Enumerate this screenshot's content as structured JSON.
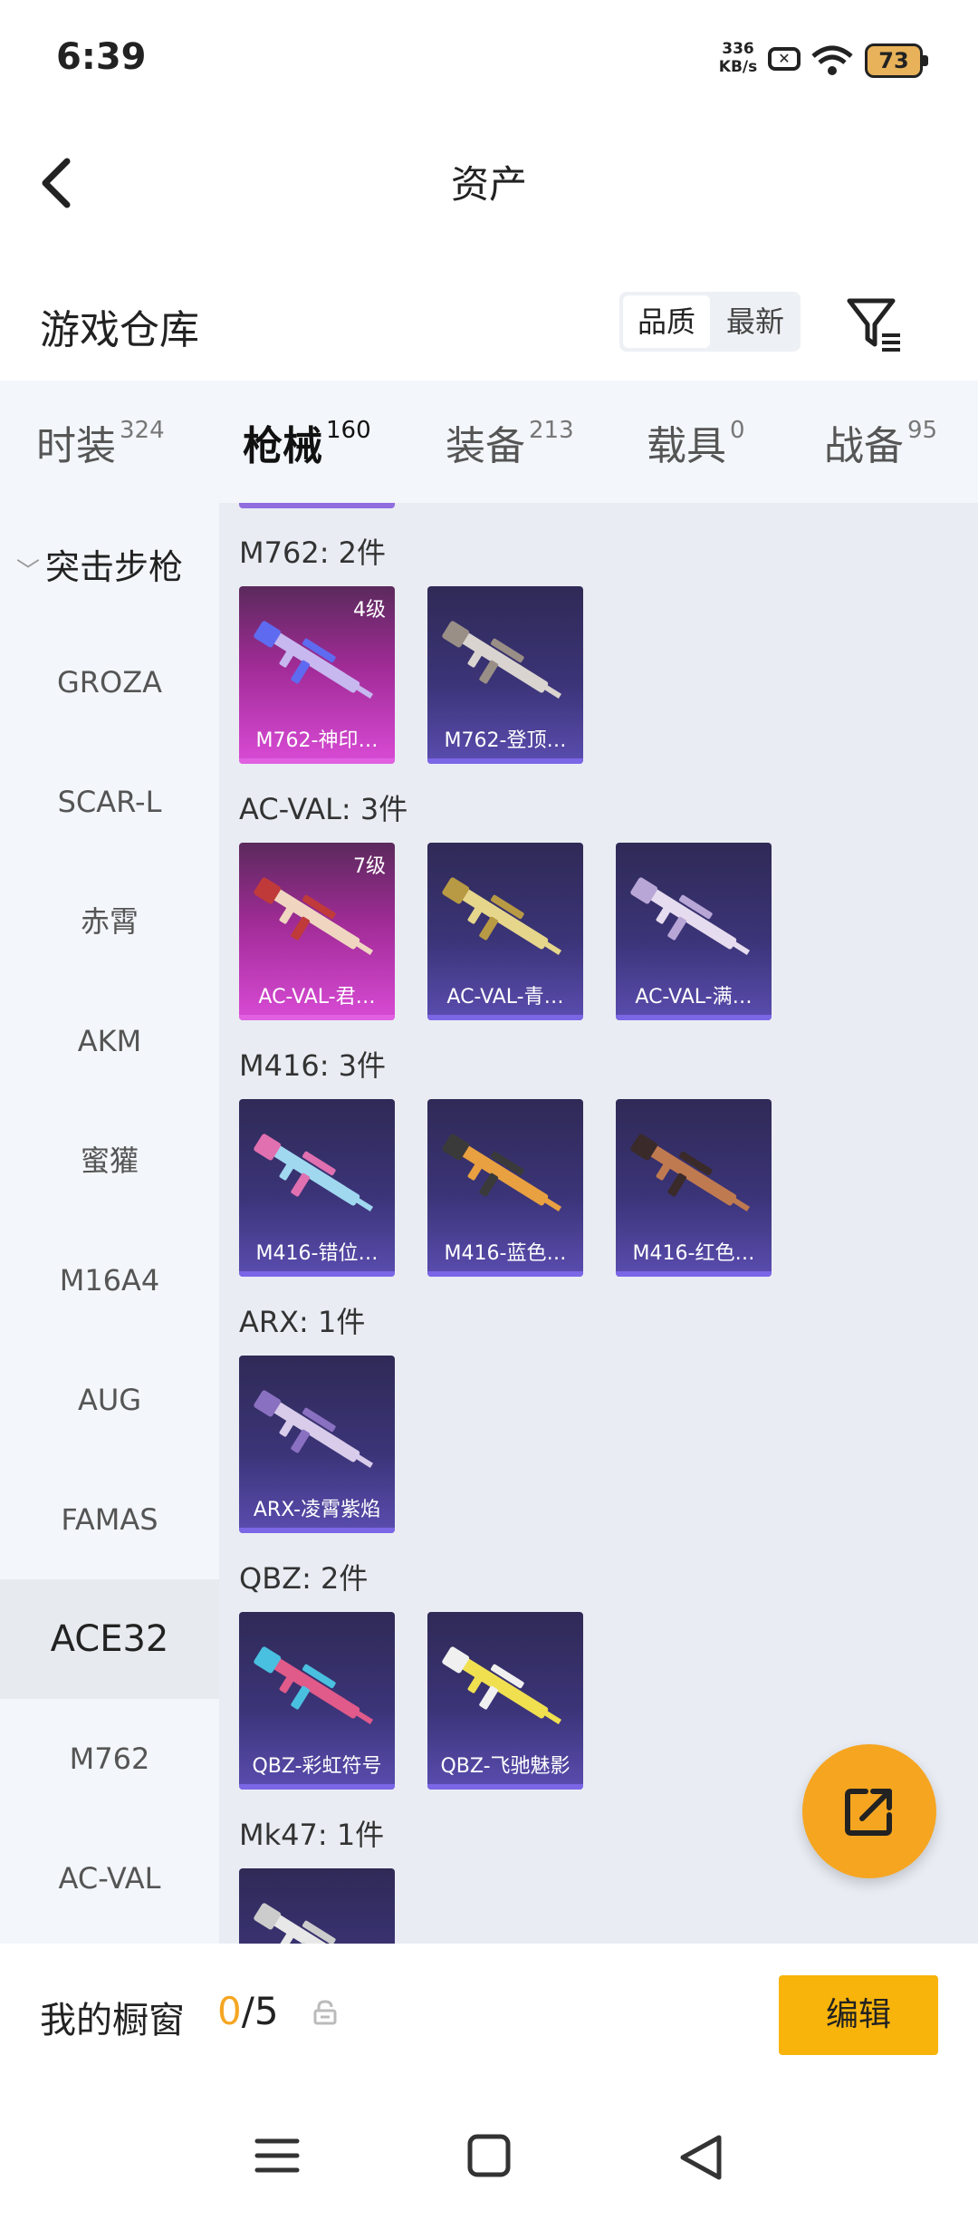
{
  "status": {
    "time": "6:39",
    "net_speed": "336",
    "net_unit": "KB/s",
    "wifi_sub": "6",
    "battery": "73"
  },
  "header": {
    "title": "资产"
  },
  "warehouse": {
    "title": "游戏仓库",
    "sort_quality": "品质",
    "sort_newest": "最新"
  },
  "tabs": [
    {
      "label": "时装",
      "count": "324"
    },
    {
      "label": "枪械",
      "count": "160"
    },
    {
      "label": "装备",
      "count": "213"
    },
    {
      "label": "载具",
      "count": "0"
    },
    {
      "label": "战备",
      "count": "95"
    }
  ],
  "sidebar": {
    "group": "突击步枪",
    "items": [
      "GROZA",
      "SCAR-L",
      "赤霄",
      "AKM",
      "蜜獾",
      "M16A4",
      "AUG",
      "FAMAS",
      "ACE32",
      "M762",
      "AC-VAL"
    ]
  },
  "sections": [
    {
      "label": "M762: 2件",
      "items": [
        {
          "name": "M762-神印…",
          "tier": "4级",
          "style": "pink",
          "gun_color": "#c7b8f0",
          "accent": "#5e6bf0"
        },
        {
          "name": "M762-登顶…",
          "tier": "",
          "style": "purple",
          "gun_color": "#d9d4cf",
          "accent": "#9a8f86"
        }
      ]
    },
    {
      "label": "AC-VAL: 3件",
      "items": [
        {
          "name": "AC-VAL-君…",
          "tier": "7级",
          "style": "pink",
          "gun_color": "#f0d6c0",
          "accent": "#c03a3a"
        },
        {
          "name": "AC-VAL-青…",
          "tier": "",
          "style": "purple",
          "gun_color": "#e6d68c",
          "accent": "#b89a44"
        },
        {
          "name": "AC-VAL-满…",
          "tier": "",
          "style": "purple",
          "gun_color": "#e6dcef",
          "accent": "#b8a6d6"
        }
      ]
    },
    {
      "label": "M416: 3件",
      "items": [
        {
          "name": "M416-错位…",
          "tier": "",
          "style": "purple",
          "gun_color": "#a0d8f0",
          "accent": "#e070b0"
        },
        {
          "name": "M416-蓝色…",
          "tier": "",
          "style": "purple",
          "gun_color": "#e8a040",
          "accent": "#3a3a3a"
        },
        {
          "name": "M416-红色…",
          "tier": "",
          "style": "purple",
          "gun_color": "#c07a50",
          "accent": "#3a2a2a"
        }
      ]
    },
    {
      "label": "ARX: 1件",
      "items": [
        {
          "name": "ARX-凌霄紫焰",
          "tier": "",
          "style": "purple",
          "gun_color": "#d8ccea",
          "accent": "#8a70c0"
        }
      ]
    },
    {
      "label": "QBZ: 2件",
      "items": [
        {
          "name": "QBZ-彩虹符号",
          "tier": "",
          "style": "purple",
          "gun_color": "#e05a8a",
          "accent": "#4ac0e0"
        },
        {
          "name": "QBZ-飞驰魅影",
          "tier": "",
          "style": "purple",
          "gun_color": "#f0e050",
          "accent": "#f0f0f0"
        }
      ]
    },
    {
      "label": "Mk47: 1件",
      "items": [
        {
          "name": "",
          "tier": "",
          "style": "purple",
          "gun_color": "#e8e8e8",
          "accent": "#cccccc"
        }
      ]
    }
  ],
  "showcase": {
    "label": "我的橱窗",
    "count": "0",
    "total": "/5",
    "edit": "编辑"
  },
  "colors": {
    "accent": "#f5a623",
    "button": "#f8b40a",
    "card_purple": "#3b3478",
    "card_pink": "#d94bd6"
  },
  "icons": [
    "back-icon",
    "filter-icon",
    "share-icon",
    "lock-icon",
    "menu-nav-icon",
    "home-nav-icon",
    "back-nav-icon"
  ]
}
